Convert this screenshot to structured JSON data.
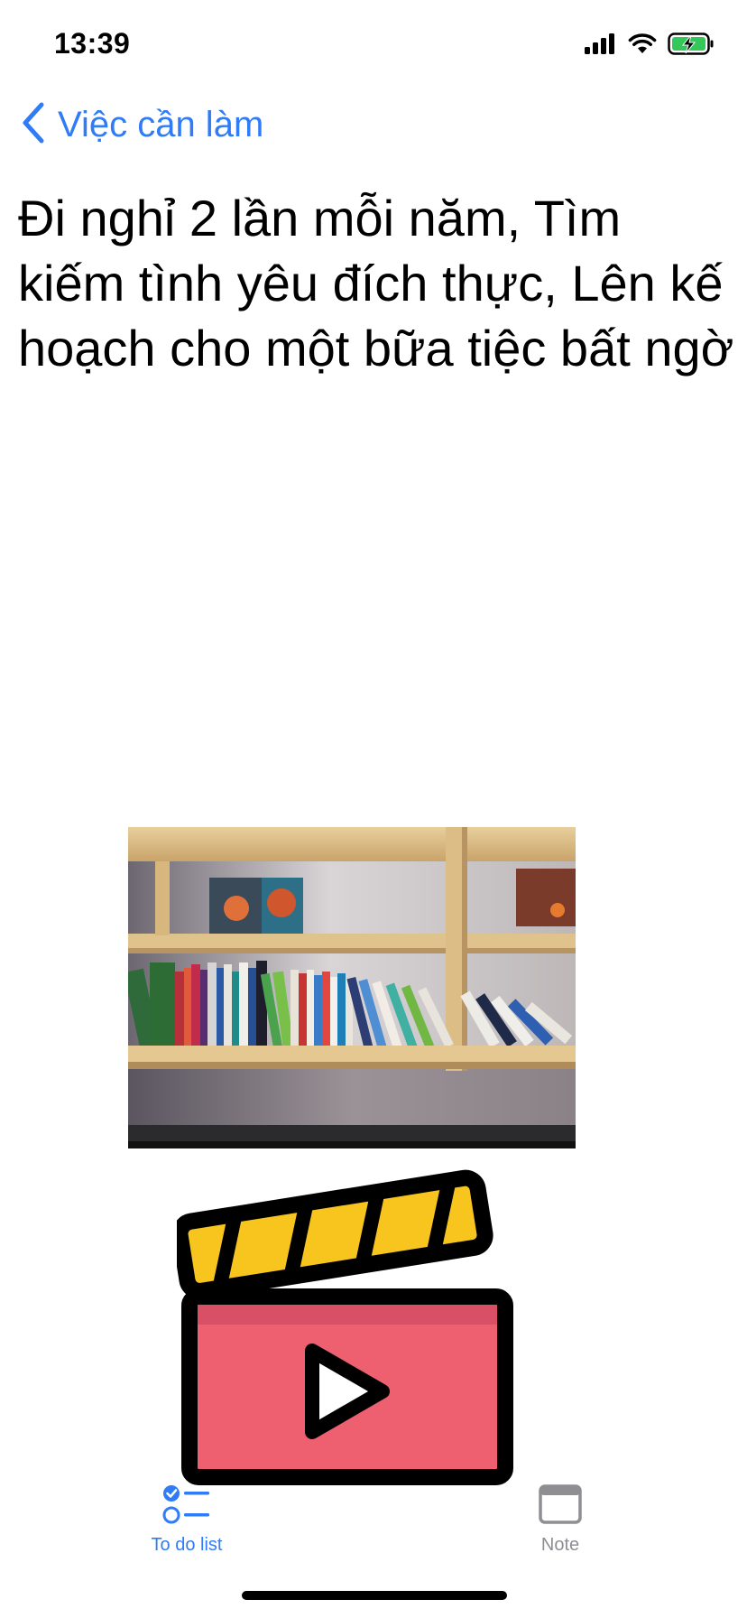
{
  "status_bar": {
    "time": "13:39",
    "icons": [
      "cellular-signal-icon",
      "wifi-icon",
      "battery-charging-icon"
    ]
  },
  "nav": {
    "back_label": "Việc cần làm"
  },
  "note": {
    "title": "Đi nghỉ 2 lần mỗi năm, Tìm kiếm tình yêu đích thực, Lên kế hoạch cho một bữa tiệc bất ngờ"
  },
  "attachments": [
    "bookshelf-photo",
    "movie-clapper-icon"
  ],
  "tab_bar": {
    "tabs": [
      {
        "label": "To do list",
        "icon": "checklist-icon",
        "selected": true
      },
      {
        "label": "Note",
        "icon": "window-icon",
        "selected": false
      }
    ]
  },
  "colors": {
    "accent": "#2F7CF6",
    "inactive": "#8E8E93",
    "battery": "#34C759",
    "clapper_red": "#EE6070",
    "clapper_yellow": "#F7C51E"
  }
}
